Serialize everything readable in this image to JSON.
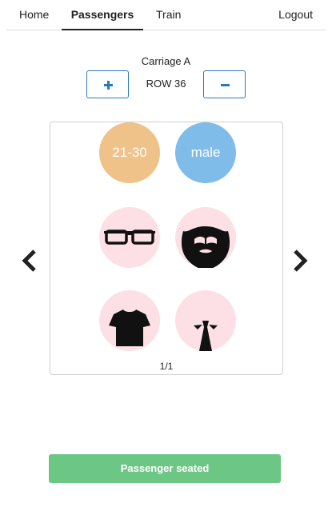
{
  "nav": {
    "home": "Home",
    "passengers": "Passengers",
    "train": "Train",
    "logout": "Logout"
  },
  "carriage": {
    "title": "Carriage A",
    "row_label": "ROW 36"
  },
  "card": {
    "age_label": "21-30",
    "gender_label": "male",
    "attributes": [
      "glasses-icon",
      "beard-icon",
      "tshirt-icon",
      "tie-icon"
    ],
    "pager": "1/1"
  },
  "colors": {
    "age": "#efc289",
    "gender": "#7fbce9",
    "attribute_bg": "#fde0e5",
    "accent": "#2a7ab8",
    "submit": "#6cc784"
  },
  "submit": {
    "label": "Passenger seated"
  }
}
